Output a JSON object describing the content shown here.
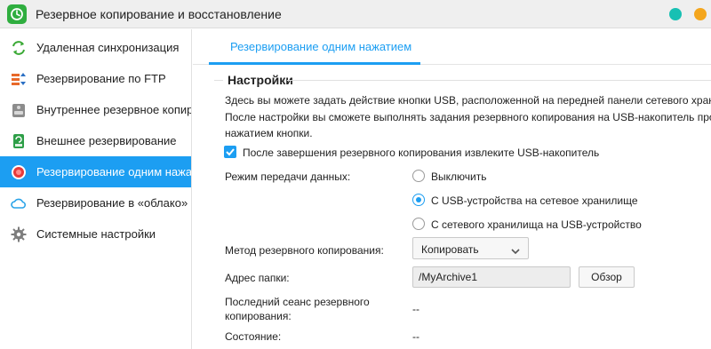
{
  "window": {
    "title": "Резервное копирование и восстановление",
    "app_icon": "backup-restore-icon",
    "controls": [
      {
        "name": "minimize-dot",
        "color": "#17c0b3"
      },
      {
        "name": "window-dot",
        "color": "#f4a61d"
      }
    ]
  },
  "sidebar": {
    "items": [
      {
        "label": "Удаленная синхронизация",
        "icon": "remote-sync-icon",
        "active": false
      },
      {
        "label": "Резервирование по FTP",
        "icon": "ftp-icon",
        "active": false
      },
      {
        "label": "Внутреннее резервное копиров",
        "icon": "internal-backup-icon",
        "active": false
      },
      {
        "label": "Внешнее резервирование",
        "icon": "external-backup-icon",
        "active": false
      },
      {
        "label": "Резервирование одним нажати",
        "icon": "one-touch-icon",
        "active": true
      },
      {
        "label": "Резервирование в «облако»",
        "icon": "cloud-icon",
        "active": false
      },
      {
        "label": "Системные настройки",
        "icon": "gear-icon",
        "active": false
      }
    ]
  },
  "main": {
    "tab_label": "Резервирование одним нажатием",
    "section_title": "Настройки",
    "description": [
      "Здесь вы можете задать действие кнопки USB, расположенной на передней панели сетевого хранилища.",
      "После настройки вы сможете выполнять задания резервного копирования на USB-накопитель простым",
      "нажатием кнопки."
    ],
    "eject_checkbox": {
      "label": "После завершения резервного копирования извлеките USB-накопитель",
      "checked": true
    },
    "transfer_mode": {
      "label": "Режим передачи данных:",
      "options": [
        {
          "label": "Выключить",
          "selected": false
        },
        {
          "label": "С USB-устройства на сетевое хранилище",
          "selected": true
        },
        {
          "label": "С сетевого хранилища на USB-устройство",
          "selected": false
        }
      ]
    },
    "backup_method": {
      "label": "Метод резервного копирования:",
      "value": "Копировать"
    },
    "folder": {
      "label": "Адрес папки:",
      "value": "/MyArchive1",
      "browse_label": "Обзор"
    },
    "last_session": {
      "label_line1": "Последний сеанс резервного",
      "label_line2": "копирования:",
      "value": "--"
    },
    "state": {
      "label": "Состояние:",
      "value": "--"
    }
  },
  "colors": {
    "accent": "#1c9ef2",
    "app_icon": "#2fae3f"
  }
}
